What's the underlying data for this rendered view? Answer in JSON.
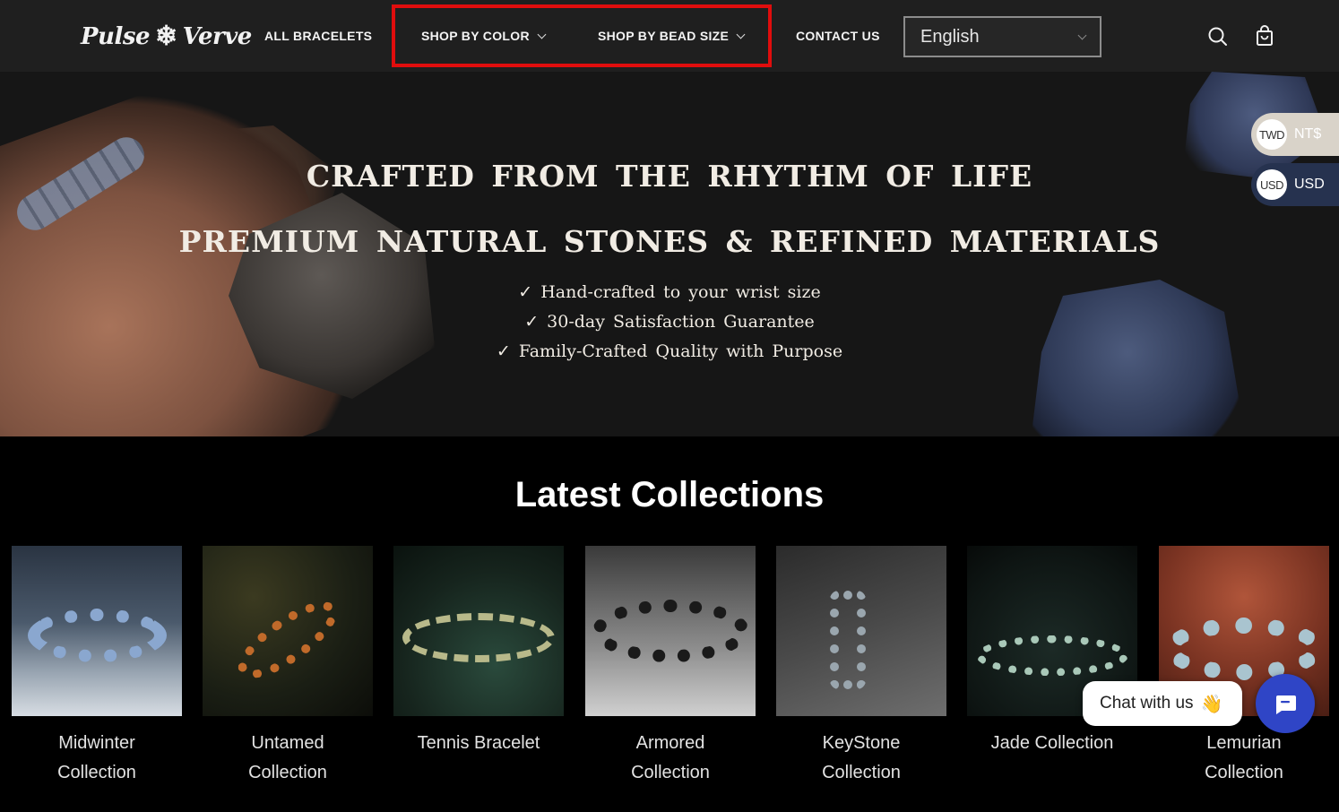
{
  "header": {
    "logo": {
      "left": "Pulse",
      "right": "Verve",
      "mark": "❄"
    },
    "nav": {
      "all_bracelets": "ALL BRACELETS",
      "shop_by_color": "SHOP BY COLOR",
      "shop_by_bead_size": "SHOP BY BEAD SIZE",
      "contact_us": "CONTACT US"
    },
    "language": {
      "selected": "English"
    },
    "icons": {
      "search": "search-icon",
      "cart": "cart-icon"
    },
    "highlight_color": "#e00d0d"
  },
  "hero": {
    "title_line1": "CRAFTED FROM THE RHYTHM OF LIFE",
    "title_line2": "PREMIUM NATURAL STONES & REFINED MATERIALS",
    "points": [
      "✓ Hand-crafted to your wrist size",
      "✓ 30-day Satisfaction Guarantee",
      "✓ Family-Crafted Quality with Purpose"
    ]
  },
  "currency": {
    "options": [
      {
        "badge": "TWD",
        "label": "NT$"
      },
      {
        "badge": "USD",
        "label": "USD"
      }
    ]
  },
  "collections": {
    "title": "Latest Collections",
    "items": [
      {
        "line1": "Midwinter",
        "line2": "Collection"
      },
      {
        "line1": "Untamed",
        "line2": "Collection"
      },
      {
        "line1": "Tennis Bracelet",
        "line2": ""
      },
      {
        "line1": "Armored",
        "line2": "Collection"
      },
      {
        "line1": "KeyStone",
        "line2": "Collection"
      },
      {
        "line1": "Jade Collection",
        "line2": ""
      },
      {
        "line1": "Lemurian",
        "line2": "Collection"
      }
    ]
  },
  "chat": {
    "label": "Chat with us",
    "emoji": "👋",
    "button_color": "#2f45c6"
  }
}
